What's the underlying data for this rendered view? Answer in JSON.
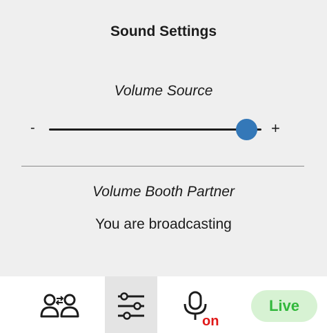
{
  "header": {
    "title": "Sound Settings"
  },
  "volume_source": {
    "label": "Volume Source",
    "min_label": "-",
    "max_label": "+",
    "level_fraction": 0.93
  },
  "partner": {
    "label": "Volume Booth Partner",
    "status": "You are broadcasting"
  },
  "bottom_bar": {
    "tabs": [
      {
        "icon": "swap-partner-icon"
      },
      {
        "icon": "settings-sliders-icon",
        "active": true
      },
      {
        "icon": "microphone-icon",
        "state_label": "on"
      },
      {
        "live_label": "Live"
      }
    ]
  },
  "colors": {
    "slider_thumb": "#3478b8",
    "mic_state": "#e01818",
    "live_text": "#32b83c",
    "live_bg": "#d7f2d3"
  }
}
